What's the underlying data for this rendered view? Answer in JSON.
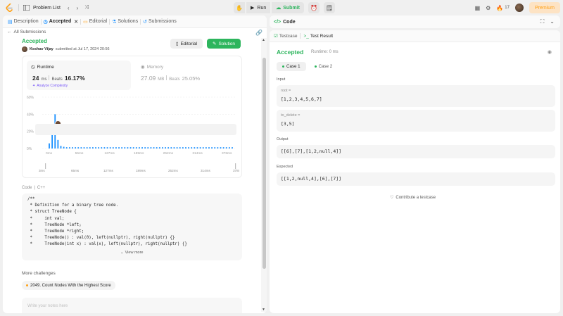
{
  "topbar": {
    "problem_list": "Problem List",
    "run": "Run",
    "submit": "Submit",
    "streak": "17",
    "premium": "Premium"
  },
  "left_tabs": [
    {
      "label": "Description",
      "icon": "description-icon"
    },
    {
      "label": "Accepted",
      "icon": "clock-icon"
    },
    {
      "label": "Editorial",
      "icon": "book-icon"
    },
    {
      "label": "Solutions",
      "icon": "flask-icon"
    },
    {
      "label": "Submissions",
      "icon": "history-icon"
    }
  ],
  "submission": {
    "back_label": "All Submissions",
    "status": "Accepted",
    "user": "Keshav Vijay",
    "submitted_text": "submitted at Jul 17, 2024 20:56",
    "editorial_btn": "Editorial",
    "solution_btn": "Solution",
    "runtime_title": "Runtime",
    "runtime_value": "24",
    "runtime_unit": "ms",
    "beats_label": "Beats",
    "runtime_beats": "16.17%",
    "analyze_label": "Analyze Complexity",
    "memory_title": "Memory",
    "memory_value": "27.09",
    "memory_unit": "MB",
    "memory_beats": "25.05%"
  },
  "chart_data": {
    "type": "bar",
    "ylim": [
      0,
      60
    ],
    "y_ticks": [
      "60%",
      "40%",
      "20%",
      "0%"
    ],
    "x_ticks": [
      "0ms",
      "55ms",
      "127ms",
      "189ms",
      "252ms",
      "314ms",
      "378ms"
    ],
    "mini_ticks": [
      "3ms",
      "65ms",
      "127ms",
      "189ms",
      "252ms",
      "314ms",
      "378ms"
    ],
    "values": [
      6,
      24,
      40,
      10,
      3,
      2,
      1.5,
      1.5,
      1.5,
      1.5,
      1.5,
      1.5,
      1.5,
      1.5,
      1.5,
      1.5,
      1.5,
      1.5,
      1.5,
      1.5,
      1.5,
      1.5,
      1.5,
      1.5,
      1.5,
      1.5,
      1.5,
      1.5,
      1.5,
      1.5,
      1.5,
      1.5,
      1.5,
      1.5,
      1.5,
      1.5,
      1.5,
      1.5,
      1.5,
      1.5,
      1.5,
      1.5,
      1.5,
      1.5,
      1.5,
      1.5,
      1.5,
      1.5,
      1.5,
      1.5,
      1.5,
      1.5,
      1.5,
      1.5,
      1.5,
      1.5,
      1.5,
      1.5,
      1.5,
      1.5,
      1.5,
      1.5,
      1.5,
      1.5
    ],
    "highlight_index": 3,
    "color": "#1a90ff"
  },
  "code": {
    "label": "Code",
    "language": "C++",
    "lines": [
      "/**",
      " * Definition for a binary tree node.",
      " * struct TreeNode {",
      " *     int val;",
      " *     TreeNode *left;",
      " *     TreeNode *right;",
      " *     TreeNode() : val(0), left(nullptr), right(nullptr) {}",
      " *     TreeNode(int x) : val(x), left(nullptr), right(nullptr) {}"
    ],
    "view_more": "View more"
  },
  "more": {
    "title": "More challenges",
    "challenge": "2049. Count Nodes With the Highest Score",
    "notes_placeholder": "Write your notes here"
  },
  "right": {
    "code_title": "Code",
    "testcase_tab": "Testcase",
    "test_result_tab": "Test Result",
    "status": "Accepted",
    "runtime": "Runtime: 0 ms",
    "cases": [
      "Case 1",
      "Case 2"
    ],
    "input_label": "Input",
    "var_root": "root =",
    "val_root": "[1,2,3,4,5,6,7]",
    "var_del": "to_delete =",
    "val_del": "[3,5]",
    "output_label": "Output",
    "output": "[[6],[7],[1,2,null,4]]",
    "expected_label": "Expected",
    "expected": "[[1,2,null,4],[6],[7]]",
    "contribute": "Contribute a testcase"
  }
}
